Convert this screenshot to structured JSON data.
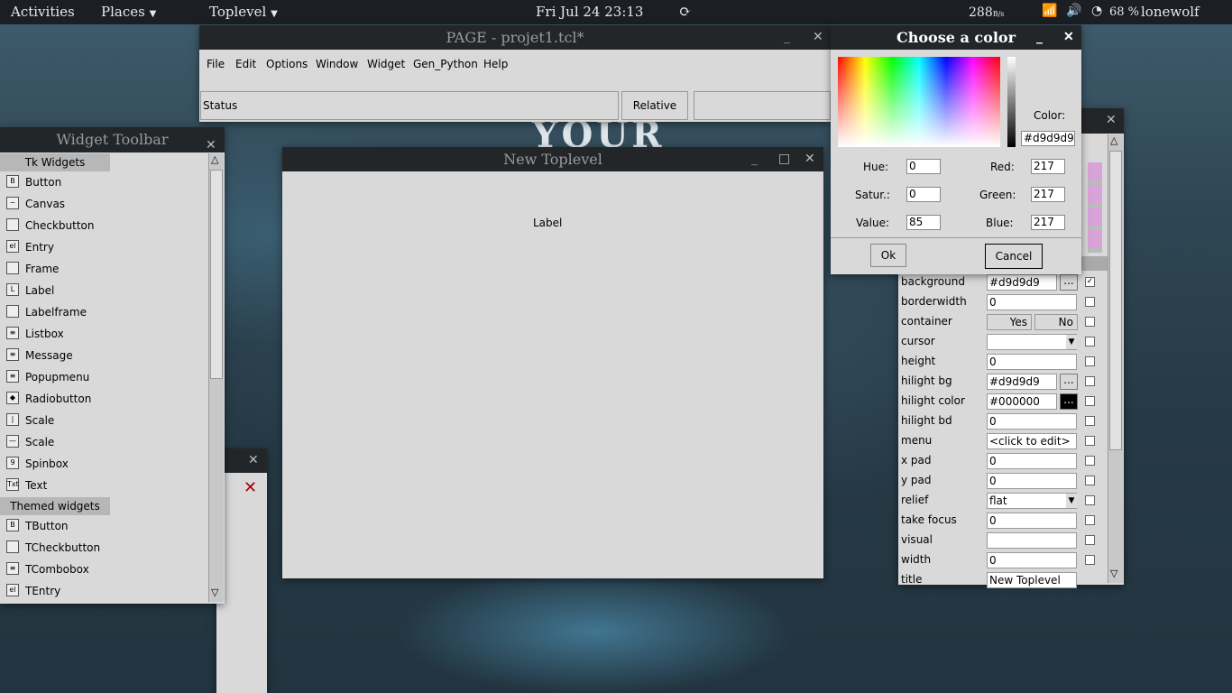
{
  "topbar": {
    "activities": "Activities",
    "places": "Places",
    "app": "Toplevel",
    "clock": "Fri Jul 24  23:13",
    "net_speed": "288",
    "net_unit": "B/s",
    "battery": "68 %",
    "user": "lonewolf"
  },
  "wallpaper_text": "YOUR",
  "page_window": {
    "title": "PAGE - projet1.tcl*",
    "menu": [
      "File",
      "Edit",
      "Options",
      "Window",
      "Widget",
      "Gen_Python",
      "Help"
    ],
    "status": "Status",
    "relative": "Relative"
  },
  "widget_toolbar": {
    "title": "Widget Toolbar",
    "tk_header": "Tk Widgets",
    "tk_items": [
      {
        "label": "Button",
        "icon": "B"
      },
      {
        "label": "Canvas",
        "icon": "~"
      },
      {
        "label": "Checkbutton",
        "icon": ""
      },
      {
        "label": "Entry",
        "icon": "el"
      },
      {
        "label": "Frame",
        "icon": ""
      },
      {
        "label": "Label",
        "icon": "L"
      },
      {
        "label": "Labelframe",
        "icon": ""
      },
      {
        "label": "Listbox",
        "icon": "≡"
      },
      {
        "label": "Message",
        "icon": "≡"
      },
      {
        "label": "Popupmenu",
        "icon": "≡"
      },
      {
        "label": "Radiobutton",
        "icon": "◆"
      },
      {
        "label": "Scale",
        "icon": "|"
      },
      {
        "label": "Scale",
        "icon": "—"
      },
      {
        "label": "Spinbox",
        "icon": "9"
      },
      {
        "label": "Text",
        "icon": "Txt"
      }
    ],
    "themed_header": "Themed widgets",
    "themed_items": [
      {
        "label": "TButton",
        "icon": "B"
      },
      {
        "label": "TCheckbutton",
        "icon": ""
      },
      {
        "label": "TCombobox",
        "icon": "≡"
      },
      {
        "label": "TEntry",
        "icon": "el"
      }
    ]
  },
  "new_toplevel": {
    "title": "New Toplevel",
    "label": "Label"
  },
  "color_dialog": {
    "title": "Choose a color",
    "color_label": "Color:",
    "color_value": "#d9d9d9",
    "hue_label": "Hue:",
    "hue": "0",
    "satur_label": "Satur.:",
    "satur": "0",
    "value_label": "Value:",
    "value": "85",
    "red_label": "Red:",
    "red": "217",
    "green_label": "Green:",
    "green": "217",
    "blue_label": "Blue:",
    "blue": "217",
    "ok": "Ok",
    "cancel": "Cancel"
  },
  "attribute_editor": {
    "rows": [
      {
        "name": "background",
        "value": "#d9d9d9",
        "checked": true
      },
      {
        "name": "borderwidth",
        "value": "0"
      },
      {
        "name": "container",
        "value": ""
      },
      {
        "name": "cursor",
        "value": ""
      },
      {
        "name": "height",
        "value": "0"
      },
      {
        "name": "hilight bg",
        "value": "#d9d9d9"
      },
      {
        "name": "hilight color",
        "value": "#000000"
      },
      {
        "name": "hilight bd",
        "value": "0"
      },
      {
        "name": "menu",
        "value": "<click to edit>"
      },
      {
        "name": "x pad",
        "value": "0"
      },
      {
        "name": "y pad",
        "value": "0"
      },
      {
        "name": "relief",
        "value": "flat"
      },
      {
        "name": "take focus",
        "value": "0"
      },
      {
        "name": "visual",
        "value": ""
      },
      {
        "name": "width",
        "value": "0"
      },
      {
        "name": "title",
        "value": "New Toplevel"
      }
    ],
    "container_yes": "Yes",
    "container_no": "No",
    "ellipsis": "..."
  },
  "colors": {
    "accent": "#d9d9d9",
    "titlebar": "#232629",
    "topbar": "#1b1f24"
  }
}
